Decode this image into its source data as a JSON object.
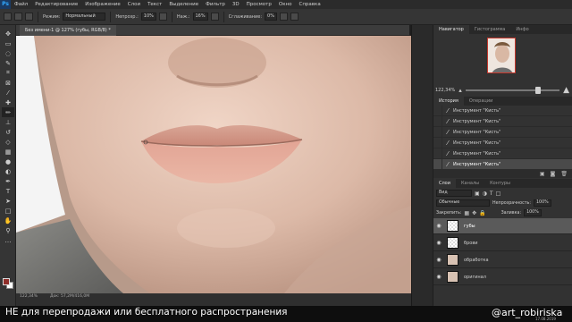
{
  "menubar": {
    "logo": "Ps",
    "items": [
      "Файл",
      "Редактирование",
      "Изображение",
      "Слои",
      "Текст",
      "Выделение",
      "Фильтр",
      "3D",
      "Просмотр",
      "Окно",
      "Справка"
    ]
  },
  "options": {
    "mode_label": "Режим:",
    "mode_value": "Нормальный",
    "opacity_label": "Непрозр.:",
    "opacity_value": "10%",
    "flow_label": "Наж.:",
    "flow_value": "16%",
    "smoothing_label": "Сглаживание:",
    "smoothing_value": "0%"
  },
  "document": {
    "tab_title": "Без имени-1 @ 127% (губы, RGB/8) *"
  },
  "status": {
    "zoom": "122,34%",
    "doc_size": "Док: 57,2M/416,0M"
  },
  "navigator": {
    "tabs": [
      "Навигатор",
      "Гистограмма",
      "Инфо"
    ],
    "zoom": "122,34%"
  },
  "history": {
    "tabs": [
      "История",
      "Операции"
    ],
    "items": [
      "Инструмент \"Кисть\"",
      "Инструмент \"Кисть\"",
      "Инструмент \"Кисть\"",
      "Инструмент \"Кисть\"",
      "Инструмент \"Кисть\"",
      "Инструмент \"Кисть\""
    ]
  },
  "layers": {
    "tabs": [
      "Слои",
      "Каналы",
      "Контуры"
    ],
    "filter": "Вид",
    "blend_mode": "Обычные",
    "opacity_label": "Непрозрачность:",
    "opacity_value": "100%",
    "lock_label": "Закрепить:",
    "fill_label": "Заливка:",
    "fill_value": "100%",
    "items": [
      {
        "name": "губы",
        "thumb": "checker"
      },
      {
        "name": "брови",
        "thumb": "checker"
      },
      {
        "name": "обработка",
        "thumb": "face"
      },
      {
        "name": "оригинал",
        "thumb": "face"
      }
    ]
  },
  "subtitle": {
    "text": "НЕ для перепродажи или бесплатного распространения",
    "watermark": "@art_robiriska",
    "date": "17.08.2019"
  },
  "colors": {
    "foreground": "#8f2e2a",
    "background": "#ffffff",
    "accent": "#c4372c"
  }
}
